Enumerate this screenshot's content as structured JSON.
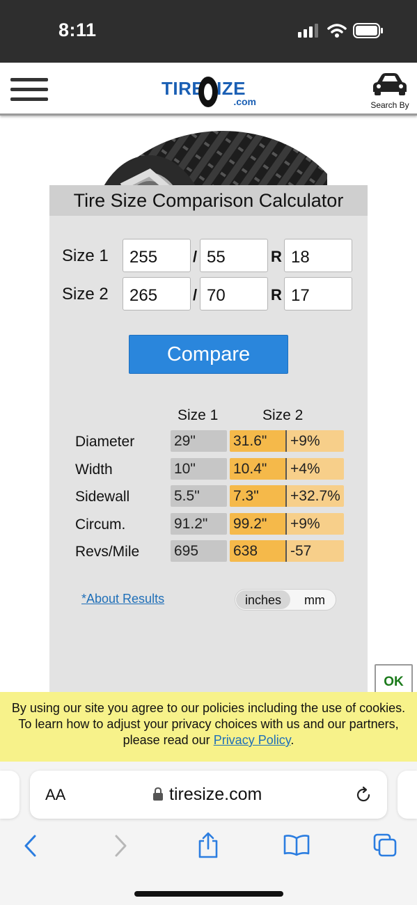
{
  "status_bar": {
    "time": "8:11"
  },
  "header": {
    "logo_main": "TIRESIZE",
    "logo_sub": ".com",
    "search_by_label": "Search By"
  },
  "calculator": {
    "title": "Tire Size Comparison Calculator",
    "size1": {
      "label": "Size 1",
      "width": "255",
      "aspect": "55",
      "rim": "18"
    },
    "size2": {
      "label": "Size 2",
      "width": "265",
      "aspect": "70",
      "rim": "17"
    },
    "slash": "/",
    "r": "R",
    "compare_label": "Compare",
    "results": {
      "col_size1": "Size 1",
      "col_size2": "Size 2",
      "rows": [
        {
          "label": "Diameter",
          "s1": "29\"",
          "s2": "31.6\"",
          "diff": "+9%"
        },
        {
          "label": "Width",
          "s1": "10\"",
          "s2": "10.4\"",
          "diff": "+4%"
        },
        {
          "label": "Sidewall",
          "s1": "5.5\"",
          "s2": "7.3\"",
          "diff": "+32.7%"
        },
        {
          "label": "Circum.",
          "s1": "91.2\"",
          "s2": "99.2\"",
          "diff": "+9%"
        },
        {
          "label": "Revs/Mile",
          "s1": "695",
          "s2": "638",
          "diff": "-57"
        }
      ]
    },
    "about_link": "*About Results",
    "units": {
      "inches": "inches",
      "mm": "mm",
      "selected": "inches"
    }
  },
  "cookie": {
    "ok_label": "OK",
    "line1": "By using our site you agree to our policies including the use of cookies.",
    "line2": "To learn how to adjust your privacy choices with us and our partners,",
    "line3_prefix": "please read our ",
    "link": "Privacy Policy",
    "line3_suffix": "."
  },
  "browser": {
    "aa_label": "AA",
    "domain": "tiresize.com"
  },
  "colors": {
    "brand_blue": "#1a5fb4",
    "compare_button": "#2a86dc",
    "size2_highlight": "#f5b94a",
    "diff_highlight": "#f7cf8a",
    "cookie_banner": "#f7f28a"
  }
}
